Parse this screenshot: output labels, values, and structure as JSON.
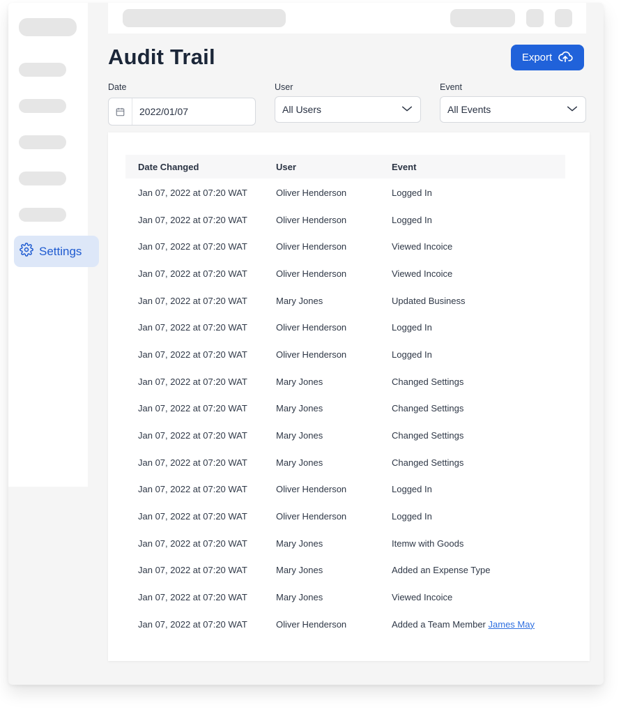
{
  "sidebar": {
    "settings_label": "Settings"
  },
  "page": {
    "title": "Audit Trail",
    "export_label": "Export"
  },
  "filters": {
    "date_label": "Date",
    "date_value": "2022/01/07",
    "user_label": "User",
    "user_value": "All Users",
    "event_label": "Event",
    "event_value": "All Events"
  },
  "table": {
    "headers": [
      "Date Changed",
      "User",
      "Event"
    ],
    "rows": [
      {
        "date": "Jan 07, 2022 at 07:20 WAT",
        "user": "Oliver Henderson",
        "event": "Logged In"
      },
      {
        "date": "Jan 07, 2022 at 07:20 WAT",
        "user": "Oliver Henderson",
        "event": "Logged In"
      },
      {
        "date": "Jan 07, 2022 at 07:20 WAT",
        "user": "Oliver Henderson",
        "event": "Viewed Incoice"
      },
      {
        "date": "Jan 07, 2022 at 07:20 WAT",
        "user": "Oliver Henderson",
        "event": "Viewed Incoice"
      },
      {
        "date": "Jan 07, 2022 at 07:20 WAT",
        "user": "Mary Jones",
        "event": "Updated Business"
      },
      {
        "date": "Jan 07, 2022 at 07:20 WAT",
        "user": "Oliver Henderson",
        "event": "Logged In"
      },
      {
        "date": "Jan 07, 2022 at 07:20 WAT",
        "user": "Oliver Henderson",
        "event": "Logged In"
      },
      {
        "date": "Jan 07, 2022 at 07:20 WAT",
        "user": "Mary Jones",
        "event": "Changed Settings"
      },
      {
        "date": "Jan 07, 2022 at 07:20 WAT",
        "user": "Mary Jones",
        "event": "Changed Settings"
      },
      {
        "date": "Jan 07, 2022 at 07:20 WAT",
        "user": "Mary Jones",
        "event": "Changed Settings"
      },
      {
        "date": "Jan 07, 2022 at 07:20 WAT",
        "user": "Mary Jones",
        "event": "Changed Settings"
      },
      {
        "date": "Jan 07, 2022 at 07:20 WAT",
        "user": "Oliver Henderson",
        "event": "Logged In"
      },
      {
        "date": "Jan 07, 2022 at 07:20 WAT",
        "user": "Oliver Henderson",
        "event": "Logged In"
      },
      {
        "date": "Jan 07, 2022 at 07:20 WAT",
        "user": "Mary Jones",
        "event": "Itemw with Goods"
      },
      {
        "date": "Jan 07, 2022 at 07:20 WAT",
        "user": "Mary Jones",
        "event": "Added an Expense Type"
      },
      {
        "date": "Jan 07, 2022 at 07:20 WAT",
        "user": "Mary Jones",
        "event": "Viewed Incoice"
      },
      {
        "date": "Jan 07, 2022 at 07:20 WAT",
        "user": "Oliver Henderson",
        "event": "Added a Team Member",
        "event_link": "James May"
      }
    ]
  },
  "icons": {
    "settings": "gear-icon",
    "export": "cloud-upload-icon",
    "date": "calendar-icon",
    "dropdown": "chevron-down-icon"
  },
  "colors": {
    "accent": "#2062da",
    "active_bg": "#dde7f8",
    "link": "#2f6fe0"
  }
}
